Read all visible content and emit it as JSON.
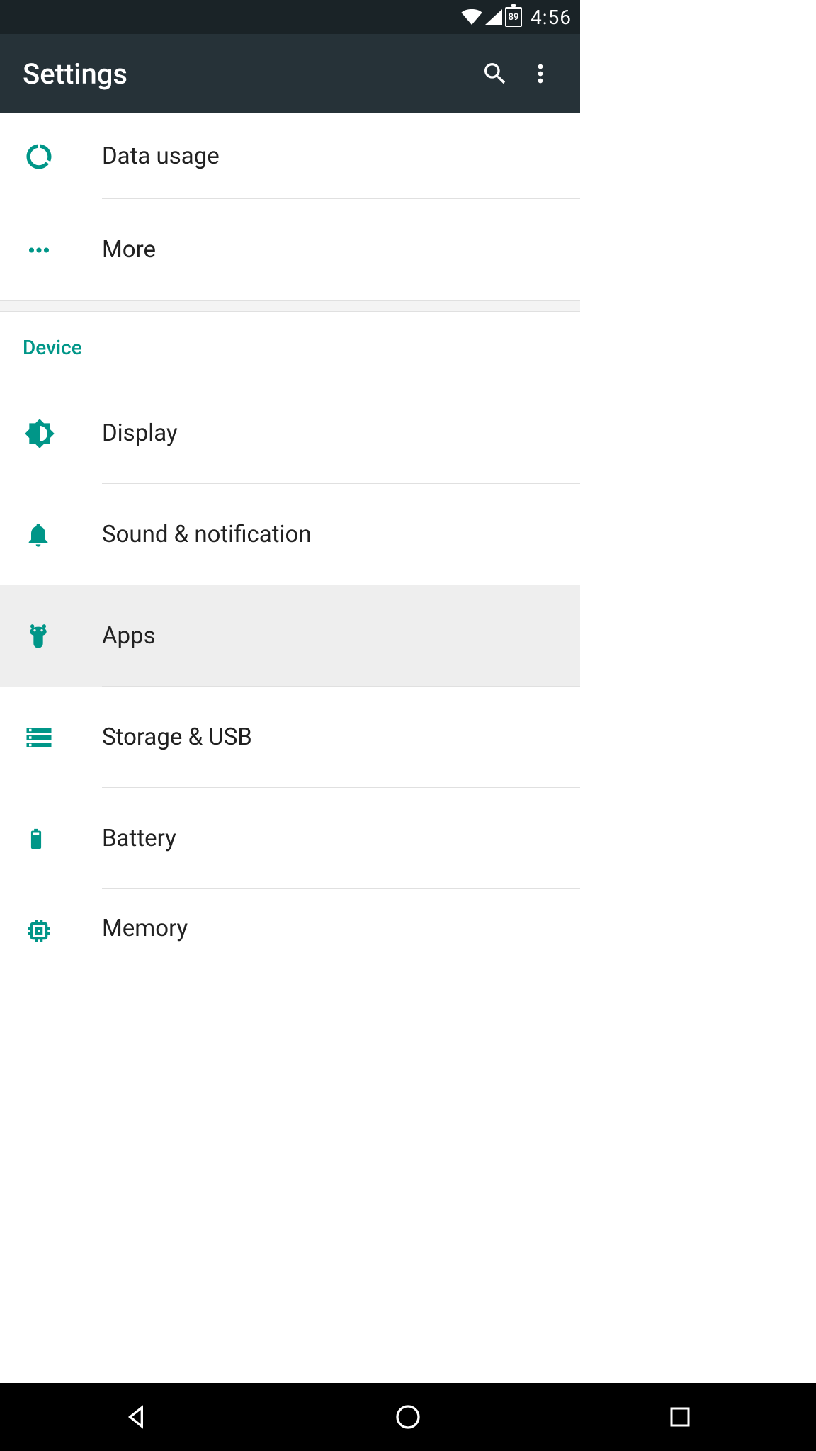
{
  "status": {
    "battery_level": "89",
    "time": "4:56"
  },
  "appbar": {
    "title": "Settings"
  },
  "items": [
    {
      "label": "Data usage",
      "icon": "data-usage-icon",
      "highlighted": false,
      "divider": true
    },
    {
      "label": "More",
      "icon": "more-icon",
      "highlighted": false,
      "divider": false
    }
  ],
  "section": {
    "header": "Device",
    "items": [
      {
        "label": "Display",
        "icon": "display-icon",
        "highlighted": false,
        "divider": true
      },
      {
        "label": "Sound & notification",
        "icon": "sound-icon",
        "highlighted": false,
        "divider": true
      },
      {
        "label": "Apps",
        "icon": "apps-icon",
        "highlighted": true,
        "divider": true
      },
      {
        "label": "Storage & USB",
        "icon": "storage-icon",
        "highlighted": false,
        "divider": true
      },
      {
        "label": "Battery",
        "icon": "battery-icon",
        "highlighted": false,
        "divider": true
      },
      {
        "label": "Memory",
        "icon": "memory-icon",
        "highlighted": false,
        "divider": false,
        "partial": true
      }
    ]
  },
  "colors": {
    "accent": "#009688"
  }
}
